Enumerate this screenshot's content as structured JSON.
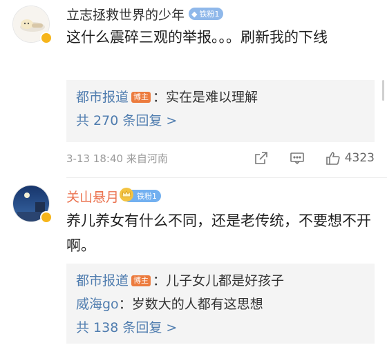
{
  "comments": [
    {
      "user": "立志拯救世界的少年",
      "fan_badge": "铁粉1",
      "text": "这什么震碎三观的举报。。。刷新我的下线",
      "replies": [
        {
          "name": "都市报道",
          "tag": "博主",
          "text": "：实在是难以理解"
        }
      ],
      "more": "共 270 条回复 >",
      "time": "3-13 18:40",
      "source": "来自河南",
      "likes": "4323"
    },
    {
      "user": "关山悬月",
      "fan_badge": "铁粉1",
      "text": "养儿养女有什么不同，还是老传统，不要想不开啊。",
      "replies": [
        {
          "name": "都市报道",
          "tag": "博主",
          "text": "：儿子女儿都是好孩子"
        },
        {
          "name": "威海go",
          "tag": "",
          "text": "：岁数大的人都有这思想"
        }
      ],
      "more": "共 138 条回复 >"
    }
  ],
  "colors": {
    "link": "#507daf",
    "highlight_name": "#eb7350",
    "host_tag": "#ec7b3e"
  },
  "icons": [
    "share-icon",
    "comment-icon",
    "like-icon",
    "verified-badge-icon",
    "crown-icon",
    "diamond-icon"
  ]
}
